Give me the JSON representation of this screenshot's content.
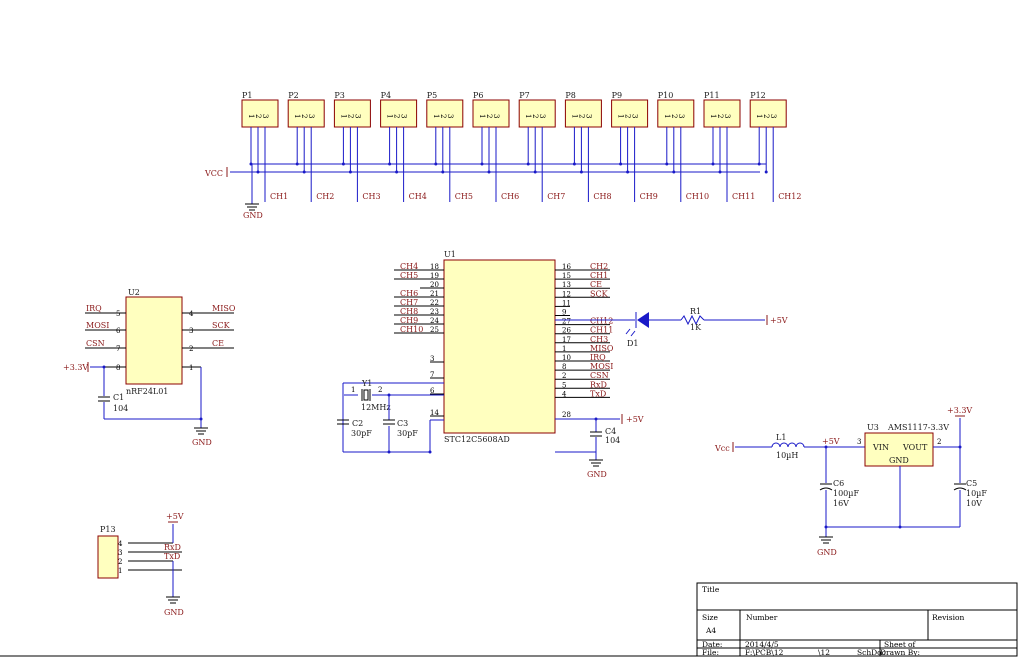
{
  "connectors": [
    {
      "ref": "P1",
      "ch": "CH1"
    },
    {
      "ref": "P2",
      "ch": "CH2"
    },
    {
      "ref": "P3",
      "ch": "CH3"
    },
    {
      "ref": "P4",
      "ch": "CH4"
    },
    {
      "ref": "P5",
      "ch": "CH5"
    },
    {
      "ref": "P6",
      "ch": "CH6"
    },
    {
      "ref": "P7",
      "ch": "CH7"
    },
    {
      "ref": "P8",
      "ch": "CH8"
    },
    {
      "ref": "P9",
      "ch": "CH9"
    },
    {
      "ref": "P10",
      "ch": "CH10"
    },
    {
      "ref": "P11",
      "ch": "CH11"
    },
    {
      "ref": "P12",
      "ch": "CH12"
    }
  ],
  "connector_pins": [
    "1",
    "2",
    "3"
  ],
  "power": {
    "vcc": "VCC",
    "vcc2": "Vcc",
    "gnd": "GND",
    "p5v": "+5V",
    "p33v": "+3.3V"
  },
  "u1": {
    "ref": "U1",
    "part": "STC12C5608AD",
    "left_pins": [
      {
        "num": "18",
        "net": "CH4"
      },
      {
        "num": "19",
        "net": "CH5"
      },
      {
        "num": "20",
        "net": ""
      },
      {
        "num": "21",
        "net": "CH6"
      },
      {
        "num": "22",
        "net": "CH7"
      },
      {
        "num": "23",
        "net": "CH8"
      },
      {
        "num": "24",
        "net": "CH9"
      },
      {
        "num": "25",
        "net": "CH10"
      },
      {
        "num": "3",
        "net": ""
      },
      {
        "num": "7",
        "net": ""
      },
      {
        "num": "6",
        "net": ""
      },
      {
        "num": "14",
        "net": ""
      }
    ],
    "right_pins": [
      {
        "num": "16",
        "net": "CH2"
      },
      {
        "num": "15",
        "net": "CH1"
      },
      {
        "num": "13",
        "net": "CE"
      },
      {
        "num": "12",
        "net": "SCK"
      },
      {
        "num": "11",
        "net": ""
      },
      {
        "num": "9",
        "net": ""
      },
      {
        "num": "27",
        "net": "CH12"
      },
      {
        "num": "26",
        "net": "CH11"
      },
      {
        "num": "17",
        "net": "CH3"
      },
      {
        "num": "1",
        "net": "MISO"
      },
      {
        "num": "10",
        "net": "IRQ"
      },
      {
        "num": "8",
        "net": "MOSI"
      },
      {
        "num": "2",
        "net": "CSN"
      },
      {
        "num": "5",
        "net": "RxD"
      },
      {
        "num": "4",
        "net": "TxD"
      },
      {
        "num": "28",
        "net": ""
      }
    ]
  },
  "u2": {
    "ref": "U2",
    "part": "nRF24L01",
    "left": [
      {
        "num": "5",
        "net": "IRQ"
      },
      {
        "num": "6",
        "net": "MOSI"
      },
      {
        "num": "7",
        "net": "CSN"
      },
      {
        "num": "8",
        "net": ""
      }
    ],
    "right": [
      {
        "num": "4",
        "net": "MISO"
      },
      {
        "num": "3",
        "net": "SCK"
      },
      {
        "num": "2",
        "net": "CE"
      },
      {
        "num": "1",
        "net": ""
      }
    ]
  },
  "u3": {
    "ref": "U3",
    "part": "AMS1117-3.3V",
    "vin": "VIN",
    "vout": "VOUT",
    "gnd": "GND",
    "pin_in": "3",
    "pin_out": "2"
  },
  "passives": {
    "c1_ref": "C1",
    "c1_val": "104",
    "c2_ref": "C2",
    "c2_val": "30pF",
    "c3_ref": "C3",
    "c3_val": "30pF",
    "c4_ref": "C4",
    "c4_val": "104",
    "c5_ref": "C5",
    "c5_val": "10µF",
    "c5_v": "10V",
    "c6_ref": "C6",
    "c6_val": "100µF",
    "c6_v": "16V",
    "y1_ref": "Y1",
    "y1_val": "12MHz",
    "y1_p1": "1",
    "y1_p2": "2",
    "r1_ref": "R1",
    "r1_val": "1K",
    "d1_ref": "D1",
    "l1_ref": "L1",
    "l1_val": "10µH"
  },
  "p13": {
    "ref": "P13",
    "pins": [
      "4",
      "3",
      "2",
      "1"
    ],
    "nets": [
      "RxD",
      "TxD"
    ]
  },
  "title_block": {
    "title": "Title",
    "size_label": "Size",
    "size": "A4",
    "number_label": "Number",
    "revision_label": "Revision",
    "date_label": "Date:",
    "date": "2014/4/5",
    "file_label": "File:",
    "file": "F:\\PCB\\12",
    "file2": "\\12",
    "sheet_label": "Sheet",
    "of_label": "of",
    "drawn_label": "Drawn By:",
    "sch_frag": "SchDoc"
  }
}
